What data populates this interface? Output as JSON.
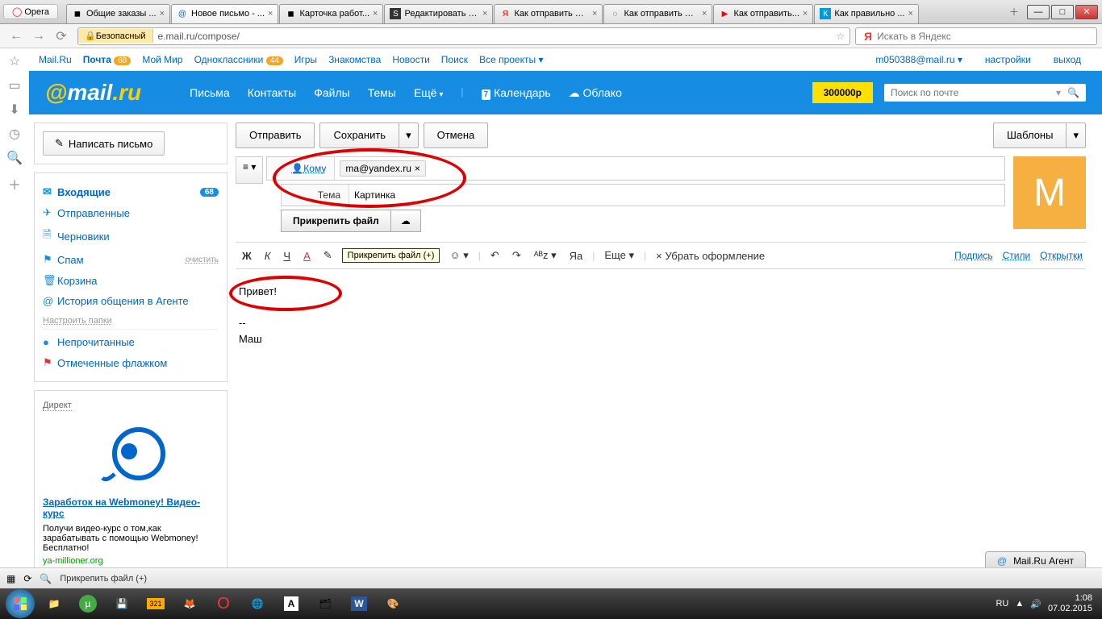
{
  "browser": {
    "label": "Opera",
    "tabs": [
      {
        "text": "Общие заказы ..."
      },
      {
        "text": "Новое письмо - ..."
      },
      {
        "text": "Карточка работ..."
      },
      {
        "text": "Редактировать з..."
      },
      {
        "text": "Как отправить ф..."
      },
      {
        "text": "Как отправить ф..."
      },
      {
        "text": "Как отправить..."
      },
      {
        "text": "Как правильно ..."
      }
    ],
    "safe": "Безопасный",
    "url": "e.mail.ru/compose/",
    "yandex_y": "Я",
    "search_ph": "Искать в Яндекс"
  },
  "topnav": {
    "mailru": "Mail.Ru",
    "pochta": "Почта",
    "pochta_badge": "68",
    "moymir": "Мой Мир",
    "odnok": "Одноклассники",
    "odnok_badge": "44",
    "igry": "Игры",
    "znak": "Знакомства",
    "novosti": "Новости",
    "poisk": "Поиск",
    "allproj": "Все проекты",
    "email": "m050388@mail.ru",
    "settings": "настройки",
    "exit": "выход"
  },
  "hdr": {
    "pisma": "Письма",
    "kont": "Контакты",
    "files": "Файлы",
    "themes": "Темы",
    "more": "Ещё",
    "cal": "Календарь",
    "cal_num": "7",
    "cloud": "Облако",
    "yellow": "300000р",
    "search_ph": "Поиск по почте"
  },
  "leftcol": {
    "compose": "Написать письмо",
    "inbox": "Входящие",
    "inbox_count": "68",
    "sent": "Отправленные",
    "drafts": "Черновики",
    "spam": "Спам",
    "clear": "очистить",
    "trash": "Корзина",
    "agent": "История общения в Агенте",
    "config": "Настроить папки",
    "unread": "Непрочитанные",
    "flagged": "Отмеченные флажком",
    "ad_title": "Директ",
    "ad_link": "Заработок на Webmoney! Видео-курс",
    "ad_text": "Получи видео-курс о том,как зарабатывать с помощью Webmoney! Бесплатно!",
    "ad_src": "ya-millioner.org"
  },
  "composer": {
    "send": "Отправить",
    "save": "Сохранить",
    "cancel": "Отмена",
    "templates": "Шаблоны",
    "to_label": "Кому",
    "to_chip": "ma@yandex.ru",
    "subj_label": "Тема",
    "subj_value": "Картинка",
    "attach": "Прикрепить файл",
    "avatar": "M"
  },
  "editor": {
    "bold": "Ж",
    "italic": "К",
    "under": "Ч",
    "tooltip": "Прикрепить файл (+)",
    "more": "Еще",
    "remove_fmt": "Убрать оформление",
    "sign": "Подпись",
    "styles": "Стили",
    "cards": "Открытки",
    "body_greet": "Привет!",
    "body_sig_dash": "--",
    "body_sig_name": "Маш"
  },
  "status": {
    "attach": "Прикрепить файл (+)"
  },
  "agentbar": {
    "text": "Mail.Ru Агент"
  },
  "tray": {
    "lang": "RU",
    "time": "1:08",
    "date": "07.02.2015"
  }
}
